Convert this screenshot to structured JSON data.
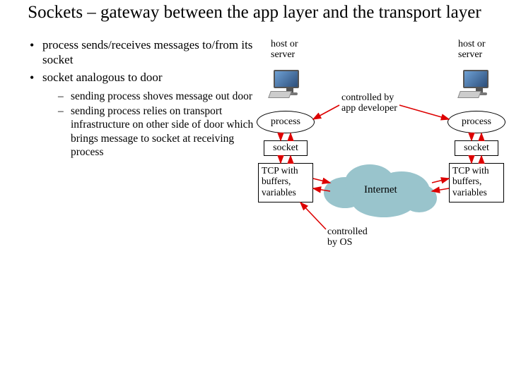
{
  "title": "Sockets – gateway between the app layer and the transport layer",
  "bullets": {
    "b1": "process sends/receives messages to/from its socket",
    "b2": "socket analogous to door",
    "s1": "sending process shoves message out door",
    "s2": "sending process relies on transport infrastructure on other side of door which brings message to socket at receiving process"
  },
  "diagram": {
    "hostLabelLeft": "host or\nserver",
    "hostLabelRight": "host or\nserver",
    "process": "process",
    "socket": "socket",
    "tcp": "TCP with buffers, variables",
    "internet": "Internet",
    "controlledDev": "controlled by\napp developer",
    "controlledOS": "controlled\nby OS"
  }
}
